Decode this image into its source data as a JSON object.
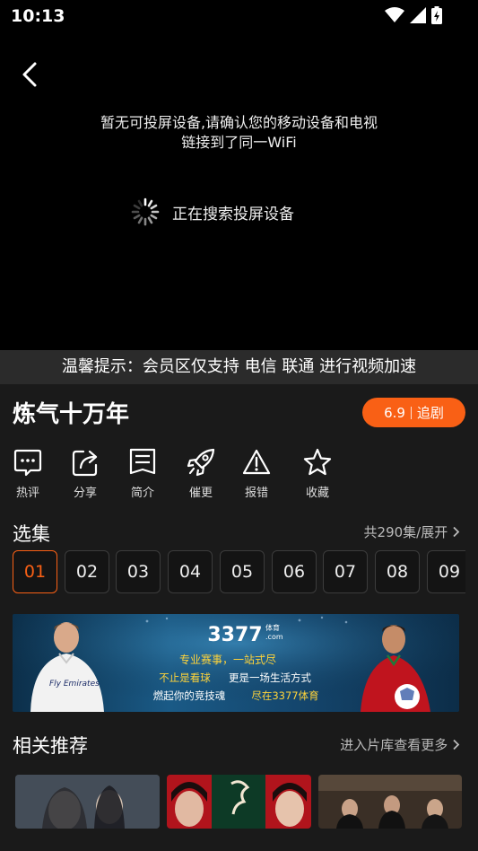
{
  "status": {
    "time": "10:13"
  },
  "player": {
    "message_line1": "暂无可投屏设备,请确认您的移动设备和电视",
    "message_line2": "链接到了同一WiFi",
    "searching": "正在搜索投屏设备"
  },
  "tip": "温馨提示：会员区仅支持 电信 联通 进行视频加速",
  "show": {
    "title": "炼气十万年",
    "rating": "6.9",
    "follow_label": "追剧"
  },
  "actions": [
    {
      "label": "热评",
      "icon": "comment-icon"
    },
    {
      "label": "分享",
      "icon": "share-icon"
    },
    {
      "label": "简介",
      "icon": "info-icon"
    },
    {
      "label": "催更",
      "icon": "rocket-icon"
    },
    {
      "label": "报错",
      "icon": "warning-icon"
    },
    {
      "label": "收藏",
      "icon": "star-icon"
    }
  ],
  "episodes": {
    "header": "选集",
    "summary": "共290集/展开",
    "items": [
      "01",
      "02",
      "03",
      "04",
      "05",
      "06",
      "07",
      "08",
      "09"
    ],
    "selected": "01"
  },
  "banner": {
    "brand_number": "3377",
    "brand_tag": "体育",
    "brand_domain": ".com",
    "line1": "专业赛事，一站式尽",
    "line2_a": "不止是看球",
    "line2_b": "更是一场生活方式",
    "line3_a": "燃起你的竞技魂",
    "line3_b": "尽在3377体育",
    "jersey_text": "Fly Emirates"
  },
  "recommend": {
    "header": "相关推荐",
    "more": "进入片库查看更多"
  },
  "colors": {
    "accent": "#f96015",
    "background": "#1a1a1a",
    "player": "#000000"
  }
}
